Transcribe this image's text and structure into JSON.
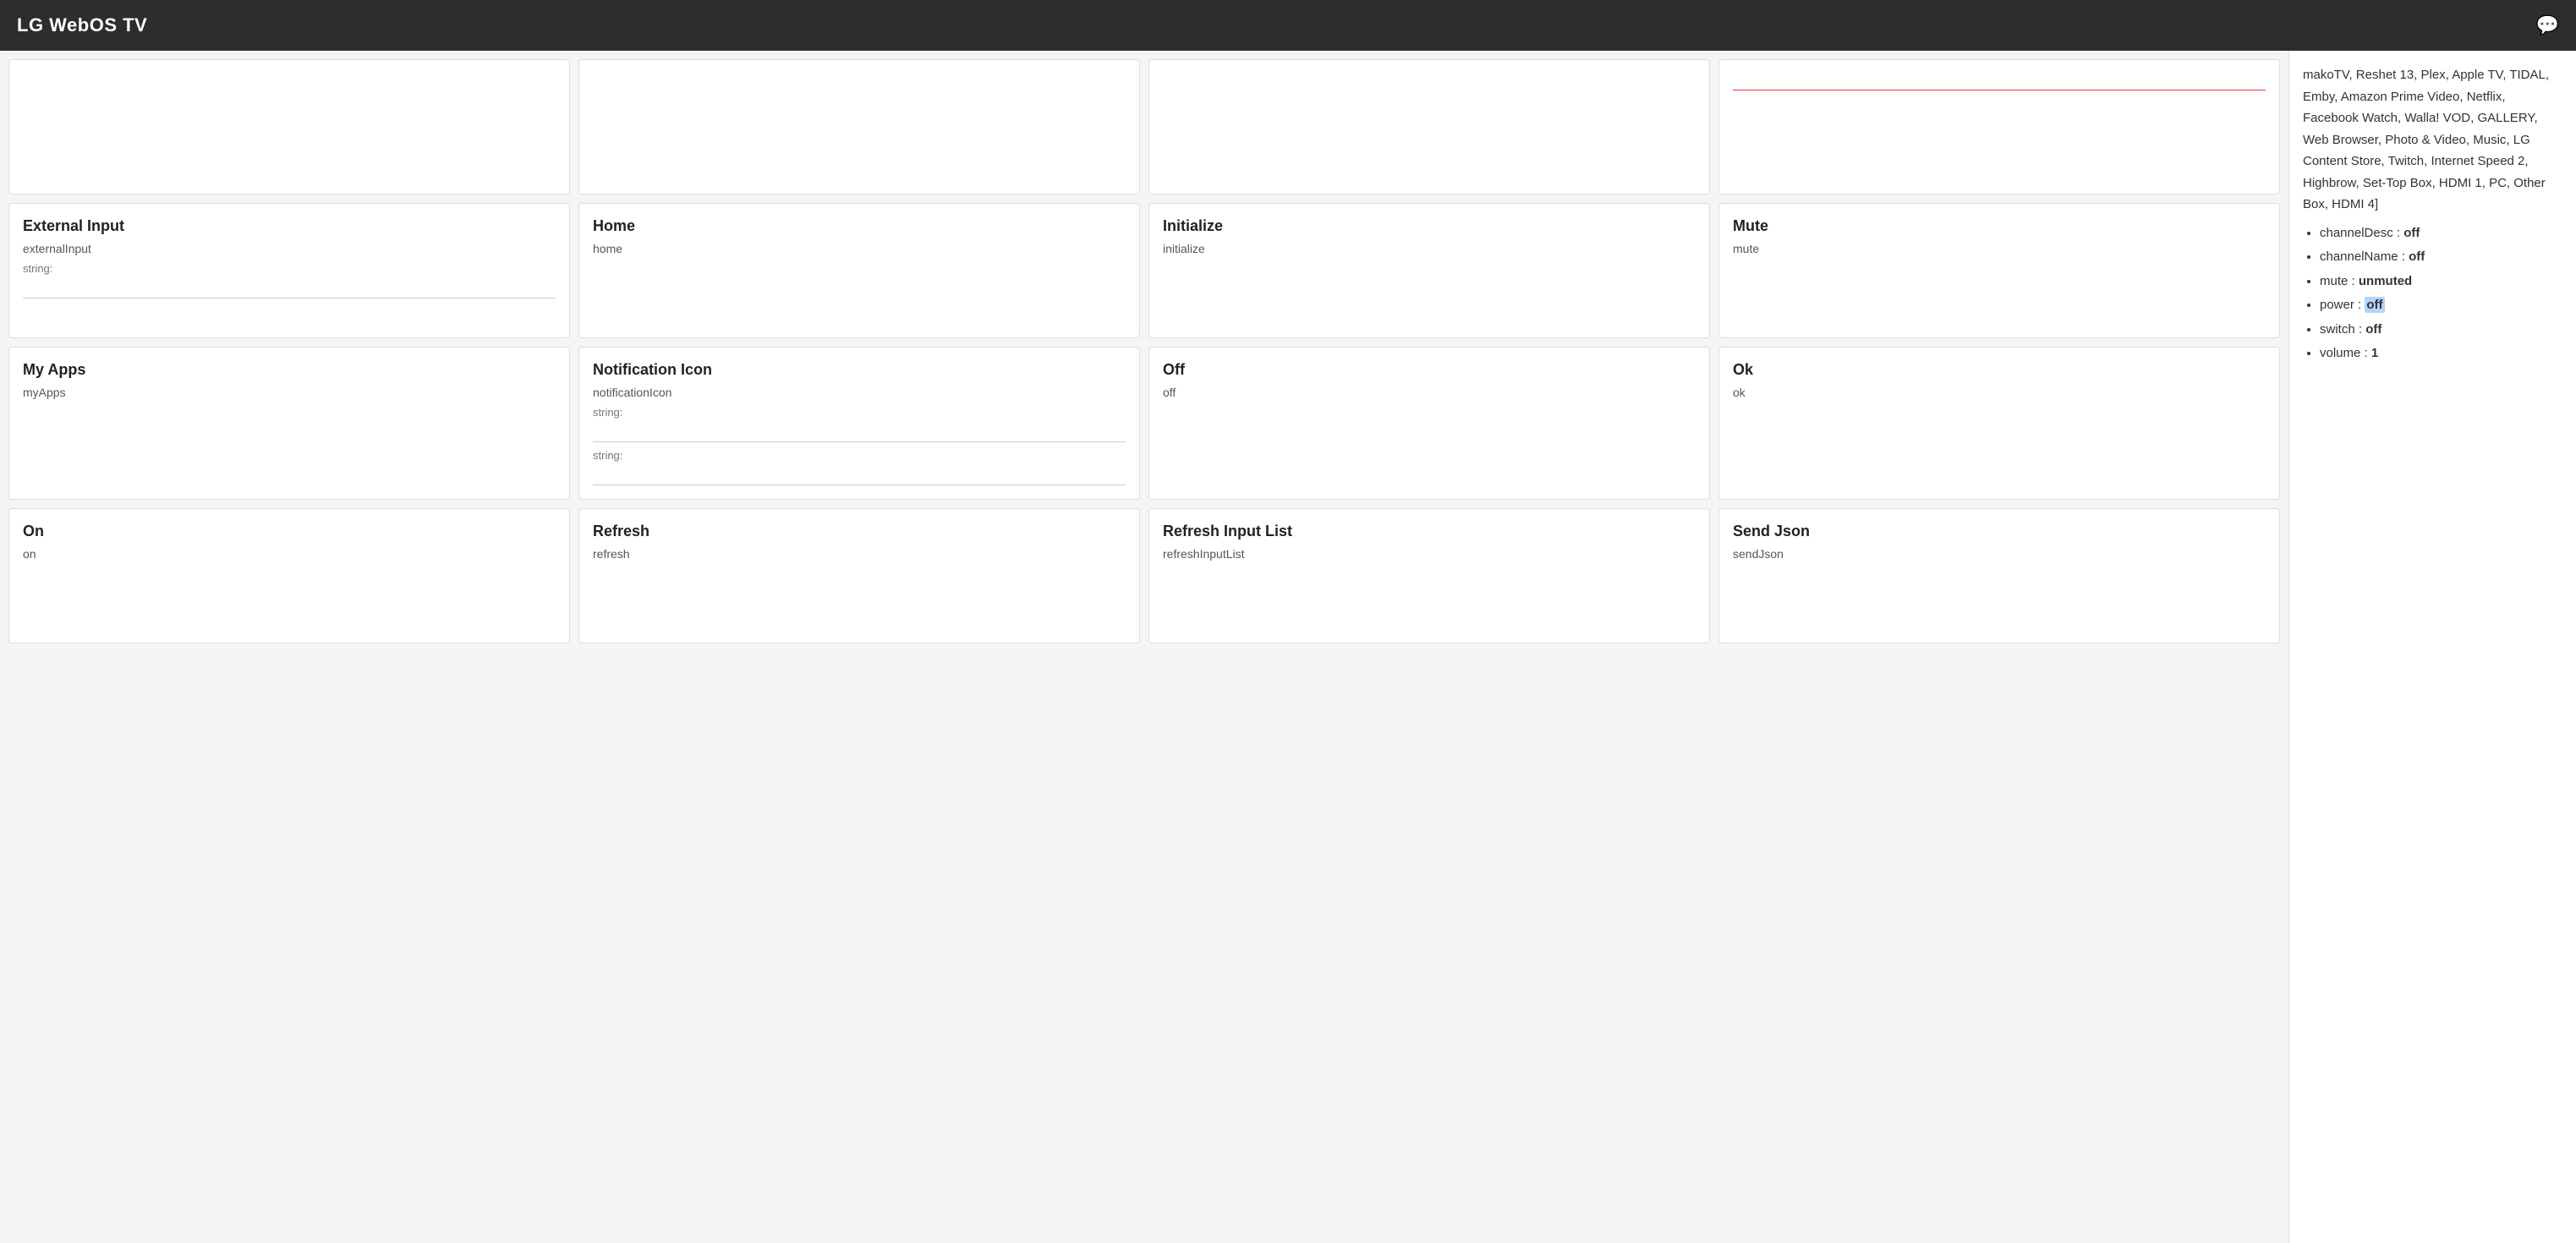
{
  "header": {
    "title": "LG WebOS TV",
    "chat_icon": "💬"
  },
  "sidebar": {
    "intro_text": "makoTV, Reshet 13, Plex, Apple TV, TIDAL, Emby, Amazon Prime Video, Netflix, Facebook Watch, Walla! VOD, GALLERY, Web Browser, Photo & Video, Music, LG Content Store, Twitch, Internet Speed 2, Highbrow, Set-Top Box, HDMI 1, PC, Other Box, HDMI 4]",
    "items": [
      {
        "key": "channelDesc",
        "separator": ":",
        "value": "off",
        "bold": true
      },
      {
        "key": "channelName",
        "separator": ":",
        "value": "off",
        "bold": true
      },
      {
        "key": "mute",
        "separator": ":",
        "value": "unmuted",
        "bold": true
      },
      {
        "key": "power",
        "separator": ":",
        "value": "off",
        "bold": true,
        "highlight": true
      },
      {
        "key": "switch",
        "separator": ":",
        "value": "off",
        "bold": true
      },
      {
        "key": "volume",
        "separator": ":",
        "value": "1",
        "bold": true
      }
    ]
  },
  "cards": [
    {
      "id": "card-partial-1",
      "title": "",
      "subtitle": "",
      "label": "",
      "input1": "",
      "input2": "",
      "showInput": false,
      "partial": true
    },
    {
      "id": "card-partial-2",
      "title": "",
      "subtitle": "",
      "label": "",
      "showInput": false,
      "partial": true
    },
    {
      "id": "card-partial-3",
      "title": "",
      "subtitle": "",
      "label": "",
      "showInput": false,
      "partial": true
    },
    {
      "id": "card-partial-4",
      "title": "",
      "subtitle": "",
      "label": "",
      "showInput": true,
      "inputRedUnderline": true,
      "partial": true
    },
    {
      "id": "card-external-input",
      "title": "External Input",
      "subtitle": "externalInput",
      "label": "string:",
      "input1": "",
      "showInput": true,
      "inputRedUnderline": false,
      "partial": false
    },
    {
      "id": "card-home",
      "title": "Home",
      "subtitle": "home",
      "label": "",
      "showInput": false,
      "partial": false
    },
    {
      "id": "card-initialize",
      "title": "Initialize",
      "subtitle": "initialize",
      "label": "",
      "showInput": false,
      "partial": false
    },
    {
      "id": "card-mute",
      "title": "Mute",
      "subtitle": "mute",
      "label": "",
      "showInput": false,
      "partial": false
    },
    {
      "id": "card-my-apps",
      "title": "My Apps",
      "subtitle": "myApps",
      "label": "",
      "showInput": false,
      "partial": false
    },
    {
      "id": "card-notification-icon",
      "title": "Notification Icon",
      "subtitle": "notificationIcon",
      "label": "string:",
      "label2": "string:",
      "showInput": true,
      "showInput2": true,
      "inputRedUnderline": false,
      "partial": false
    },
    {
      "id": "card-off",
      "title": "Off",
      "subtitle": "off",
      "label": "",
      "showInput": false,
      "partial": false
    },
    {
      "id": "card-ok",
      "title": "Ok",
      "subtitle": "ok",
      "label": "",
      "showInput": false,
      "partial": false
    },
    {
      "id": "card-on",
      "title": "On",
      "subtitle": "on",
      "label": "",
      "showInput": false,
      "partial": false
    },
    {
      "id": "card-refresh",
      "title": "Refresh",
      "subtitle": "refresh",
      "label": "",
      "showInput": false,
      "partial": false
    },
    {
      "id": "card-refresh-input-list",
      "title": "Refresh Input List",
      "subtitle": "refreshInputList",
      "label": "",
      "showInput": false,
      "partial": false
    },
    {
      "id": "card-send-json",
      "title": "Send Json",
      "subtitle": "sendJson",
      "label": "",
      "showInput": false,
      "partial": false
    }
  ]
}
